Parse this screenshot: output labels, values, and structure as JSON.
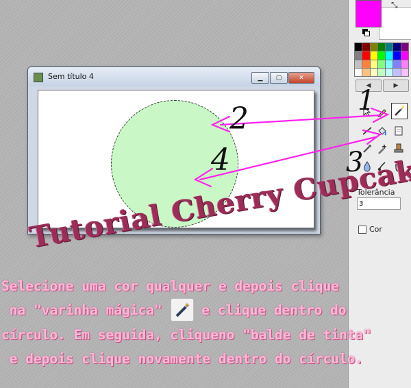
{
  "colors": {
    "primary_color": "#ff00ff",
    "secondary_color": "#ffffff",
    "circle_fill": "#c9f7c6",
    "arrow_color": "#ff22ee",
    "title_color": "#9b2d58",
    "instruction_color": "#ffb6d9"
  },
  "palette": {
    "colors": [
      "#000000",
      "#800000",
      "#808000",
      "#008000",
      "#008080",
      "#000080",
      "#800080",
      "#808080",
      "#ff0000",
      "#ffff00",
      "#00ff00",
      "#00ffff",
      "#0000ff",
      "#ff00ff",
      "#c0c0c0",
      "#ff8040",
      "#ffff80",
      "#80ff80",
      "#80ffff",
      "#8080ff",
      "#ff80ff",
      "#ffffff",
      "#ffc080",
      "#ffffc0",
      "#c0ffc0",
      "#c0ffff",
      "#c0c0ff",
      "#ffc0ff"
    ]
  },
  "window": {
    "title": "Sem título 4",
    "buttons": {
      "minimize": "▁",
      "maximize": "▢",
      "close": "✕"
    }
  },
  "tools": {
    "icons": [
      "pointer-icon",
      "pencil-icon",
      "magic-wand-icon",
      "line-icon",
      "paint-bucket-icon",
      "document-icon",
      "eyedropper-icon",
      "add-pen-icon",
      "droplet-icon",
      "stamp-icon",
      "brush-icon",
      "hand-icon"
    ],
    "nav_prev": "◀",
    "nav_next": "▶"
  },
  "tolerance": {
    "label": "Tolerância",
    "value": "3"
  },
  "color_option": {
    "label": "Cor"
  },
  "annotations": {
    "n1": "1",
    "n2": "2",
    "n3": "3",
    "n4": "4"
  },
  "tutorial_title": "Tutorial Cherry Cupcake",
  "instructions": {
    "line1": "Selecione uma cor qualquer e depois clique",
    "line2a": " na \"varinha mágica\" ",
    "line2b": " e clique dentro do",
    "line3": "círculo. Em seguida, cliqueno \"balde de tinta\"",
    "line4": " e depois clique novamente dentro do círculo."
  }
}
